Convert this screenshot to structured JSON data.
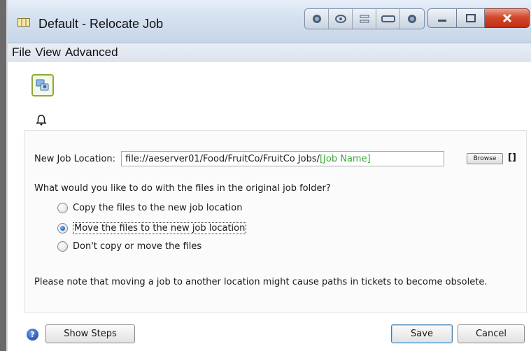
{
  "window": {
    "title": "Default - Relocate Job"
  },
  "menu": {
    "items": [
      "File",
      "View",
      "Advanced"
    ]
  },
  "toolbar": {
    "main_icon": "workflow-icon",
    "bell_icon": "bell-icon"
  },
  "location": {
    "label": "New Job Location:",
    "path_value": "file://aeserver01/Food/FruitCo/FruitCo Jobs/",
    "path_variable": "[Job Name]",
    "browse_label": "Browse",
    "brackets_label": "[]"
  },
  "question": "What would you like to do with the files in the original job folder?",
  "options": [
    {
      "label": "Copy the files to the new job location",
      "selected": false
    },
    {
      "label": "Move the files to the new job location",
      "selected": true
    },
    {
      "label": "Don't copy or move the files",
      "selected": false
    }
  ],
  "note": "Please note that moving a job to another location might cause paths in tickets to become obsolete.",
  "footer": {
    "help_label": "?",
    "show_steps_label": "Show Steps",
    "save_label": "Save",
    "cancel_label": "Cancel"
  },
  "colors": {
    "variable_text": "#3aa63a",
    "close_button": "#c22e12",
    "titlebar": "#d3e0ef"
  }
}
